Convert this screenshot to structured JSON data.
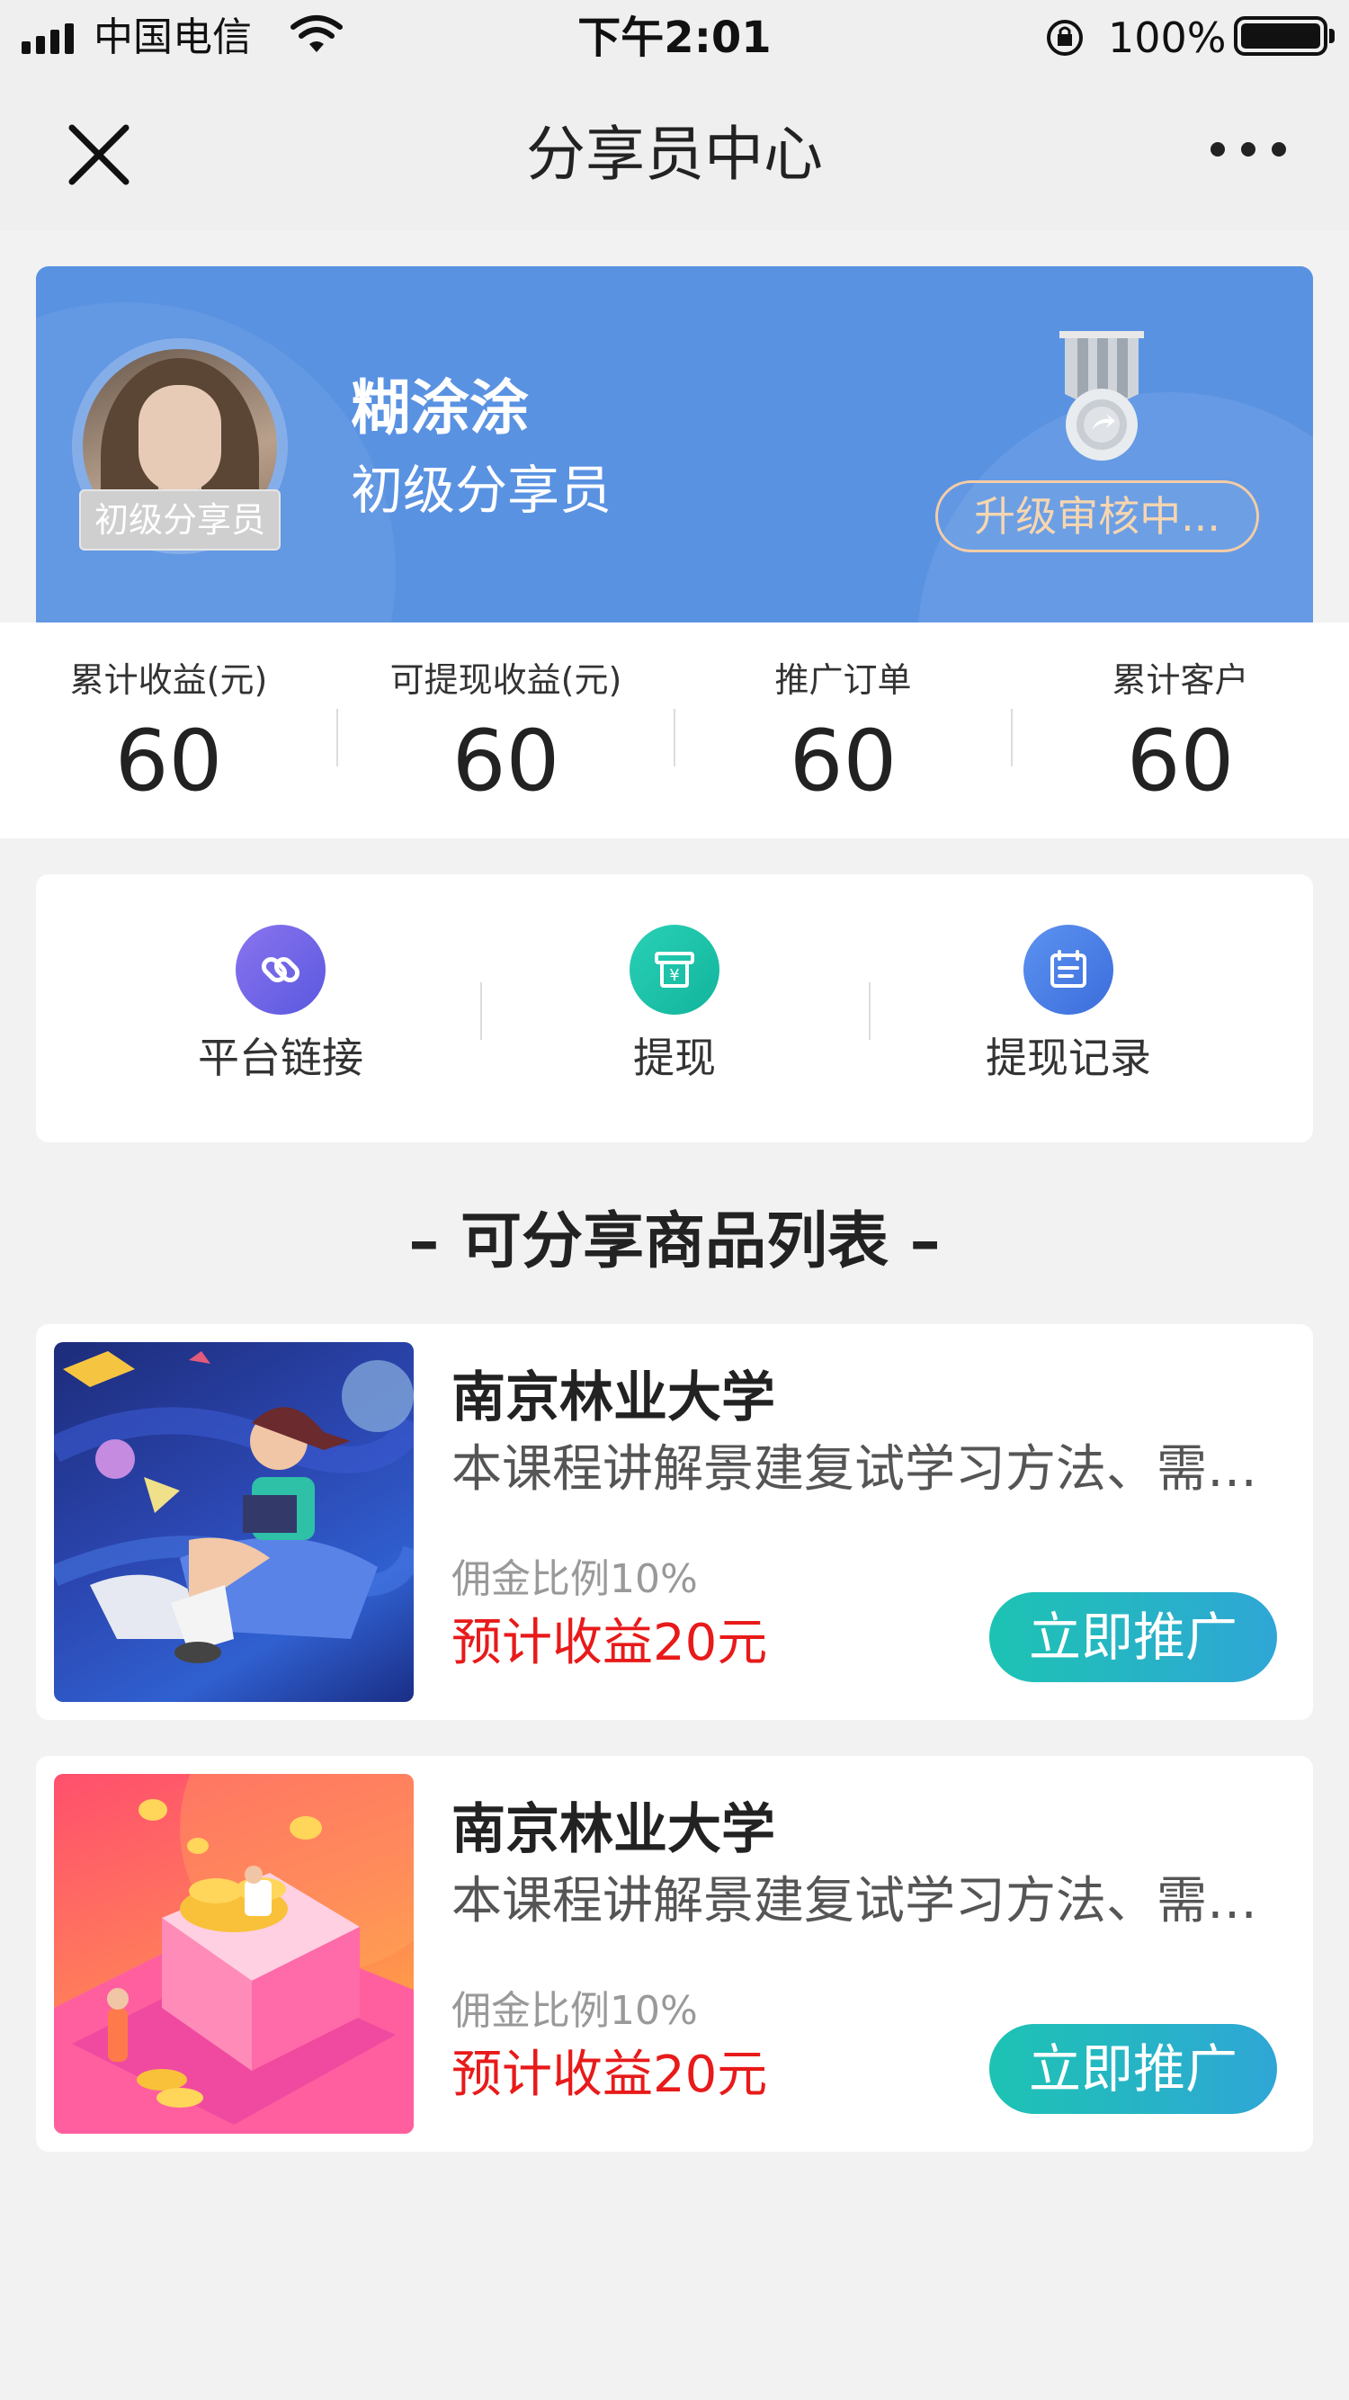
{
  "status_bar": {
    "carrier": "中国电信",
    "time": "下午2:01",
    "battery": "100%"
  },
  "nav": {
    "title": "分享员中心",
    "close_icon": "close-icon",
    "more_icon": "more-dots-icon"
  },
  "profile": {
    "name": "糊涂涂",
    "level": "初级分享员",
    "avatar_tag": "初级分享员",
    "upgrade_button": "升级审核中...",
    "accent_color": "#5a92e2"
  },
  "stats": [
    {
      "label": "累计收益(元)",
      "value": "60"
    },
    {
      "label": "可提现收益(元)",
      "value": "60"
    },
    {
      "label": "推广订单",
      "value": "60"
    },
    {
      "label": "累计客户",
      "value": "60"
    }
  ],
  "actions": [
    {
      "label": "平台链接",
      "icon": "link-icon",
      "color": "#6a63e6"
    },
    {
      "label": "提现",
      "icon": "withdraw-icon",
      "color": "#18c2a6"
    },
    {
      "label": "提现记录",
      "icon": "calendar-icon",
      "color": "#4a7ee6"
    }
  ],
  "section_title": "– 可分享商品列表 –",
  "products": [
    {
      "title": "南京林业大学",
      "desc": "本课程讲解景建复试学习方法、需要注意的问题",
      "commission": "佣金比例10%",
      "earning": "预计收益20元",
      "button": "立即推广"
    },
    {
      "title": "南京林业大学",
      "desc": "本课程讲解景建复试学习方法、需要注意的问题",
      "commission": "佣金比例10%",
      "earning": "预计收益20元",
      "button": "立即推广"
    }
  ]
}
